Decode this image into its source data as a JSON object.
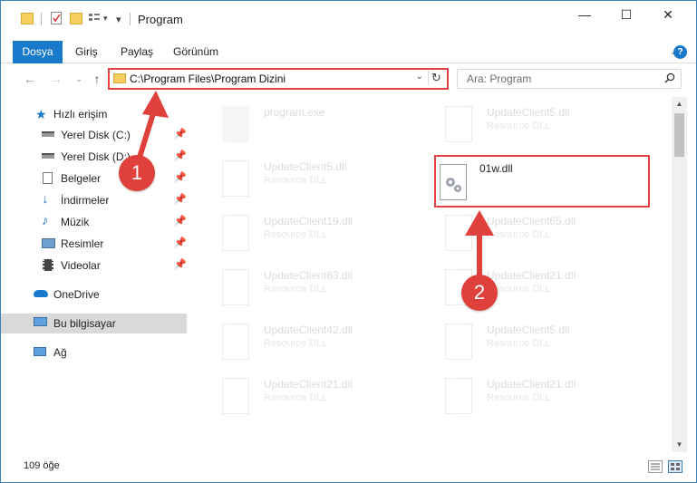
{
  "window": {
    "title": "Program",
    "controls": {
      "minimize": "—",
      "maximize": "☐",
      "close": "✕"
    }
  },
  "ribbon": {
    "tabs": [
      "Dosya",
      "Giriş",
      "Paylaş",
      "Görünüm"
    ]
  },
  "address": {
    "path": "C:\\Program Files\\Program Dizini",
    "search_placeholder": "Ara: Program"
  },
  "nav_pane": {
    "quick_access": "Hızlı erişim",
    "pinned": [
      {
        "label": "Yerel Disk (C:)",
        "icon": "drive-icon"
      },
      {
        "label": "Yerel Disk (D:)",
        "icon": "drive-icon"
      },
      {
        "label": "Belgeler",
        "icon": "documents-icon"
      },
      {
        "label": "İndirmeler",
        "icon": "downloads-icon"
      },
      {
        "label": "Müzik",
        "icon": "music-icon"
      },
      {
        "label": "Resimler",
        "icon": "pictures-icon"
      },
      {
        "label": "Videolar",
        "icon": "videos-icon"
      }
    ],
    "onedrive": "OneDrive",
    "this_pc": "Bu bilgisayar",
    "network": "Ağ"
  },
  "files": {
    "left": [
      {
        "name": "program.exe",
        "type": ""
      },
      {
        "name": "UpdateClient5.dll",
        "type": "Resource DLL"
      },
      {
        "name": "UpdateClient19.dll",
        "type": "Resource DLL"
      },
      {
        "name": "UpdateClient63.dll",
        "type": "Resource DLL"
      },
      {
        "name": "UpdateClient42.dll",
        "type": "Resource DLL"
      },
      {
        "name": "UpdateClient21.dll",
        "type": "Resource DLL"
      }
    ],
    "right": [
      {
        "name": "UpdateClient5.dll",
        "type": "Resource DLL"
      },
      {
        "name": "01w.dll",
        "type": ""
      },
      {
        "name": "UpdateClient65.dll",
        "type": "Resource DLL"
      },
      {
        "name": "UpdateClient21.dll",
        "type": "Resource DLL"
      },
      {
        "name": "UpdateClient5.dll",
        "type": "Resource DLL"
      },
      {
        "name": "UpdateClient21.dll",
        "type": "Resource DLL"
      }
    ]
  },
  "status": {
    "count": "109 öğe"
  },
  "callouts": [
    "1",
    "2"
  ],
  "colors": {
    "accent": "#1979ca",
    "highlight": "#e04040",
    "folder": "#f6cd5e"
  }
}
